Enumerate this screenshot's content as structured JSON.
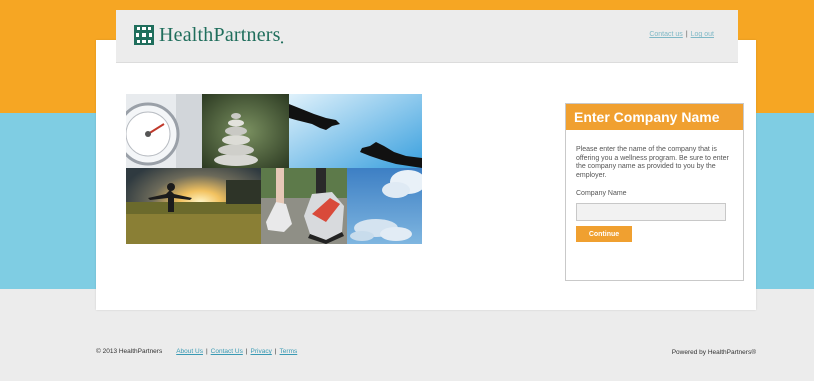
{
  "colors": {
    "orange": "#f6a623",
    "blue": "#7fcde3",
    "grey": "#ececec",
    "accent": "#f0a030",
    "logo_green": "#1f6e5c",
    "link": "#3a9ab4"
  },
  "header": {
    "logo_icon": "healthpartners-logo-icon",
    "logo_text": "HealthPartners",
    "logo_mark": "•",
    "links": {
      "contact": "Contact us",
      "separator": "|",
      "logout": "Log out"
    }
  },
  "collage": {
    "tiles": [
      "scale-photo",
      "stacked-stones-photo",
      "reaching-hands-photo",
      "sunset-field-photo",
      "running-shoes-photo",
      "blue-sky-photo"
    ]
  },
  "form": {
    "title": "Enter Company Name",
    "description": "Please enter the name of the company that is offering you a wellness program. Be sure to enter the company name as provided to you by the employer.",
    "field_label": "Company Name",
    "field_value": "",
    "field_placeholder": "",
    "button_label": "Continue"
  },
  "footer": {
    "copyright": "© 2013 HealthPartners",
    "links": {
      "about": "About Us",
      "contact": "Contact Us",
      "privacy": "Privacy",
      "terms": "Terms"
    },
    "separator": "|",
    "powered_by": "Powered by HealthPartners®"
  }
}
